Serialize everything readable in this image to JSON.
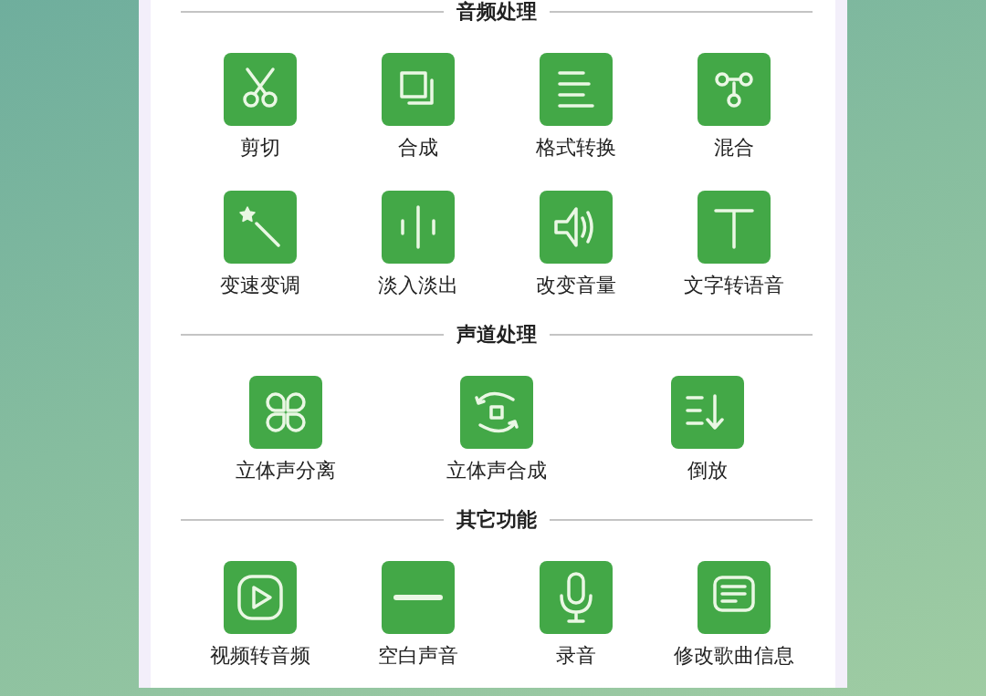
{
  "sections": [
    {
      "title": "音频处理",
      "items": [
        {
          "label": "剪切",
          "kind": "scissors"
        },
        {
          "label": "合成",
          "kind": "layers"
        },
        {
          "label": "格式转换",
          "kind": "lines"
        },
        {
          "label": "混合",
          "kind": "nodes"
        },
        {
          "label": "变速变调",
          "kind": "wand"
        },
        {
          "label": "淡入淡出",
          "kind": "wave"
        },
        {
          "label": "改变音量",
          "kind": "speaker"
        },
        {
          "label": "文字转语音",
          "kind": "text"
        }
      ]
    },
    {
      "title": "声道处理",
      "items": [
        {
          "label": "立体声分离",
          "kind": "clover"
        },
        {
          "label": "立体声合成",
          "kind": "swap"
        },
        {
          "label": "倒放",
          "kind": "sort"
        }
      ]
    },
    {
      "title": "其它功能",
      "items": [
        {
          "label": "视频转音频",
          "kind": "play"
        },
        {
          "label": "空白声音",
          "kind": "minus"
        },
        {
          "label": "录音",
          "kind": "mic"
        },
        {
          "label": "修改歌曲信息",
          "kind": "message"
        }
      ]
    }
  ]
}
